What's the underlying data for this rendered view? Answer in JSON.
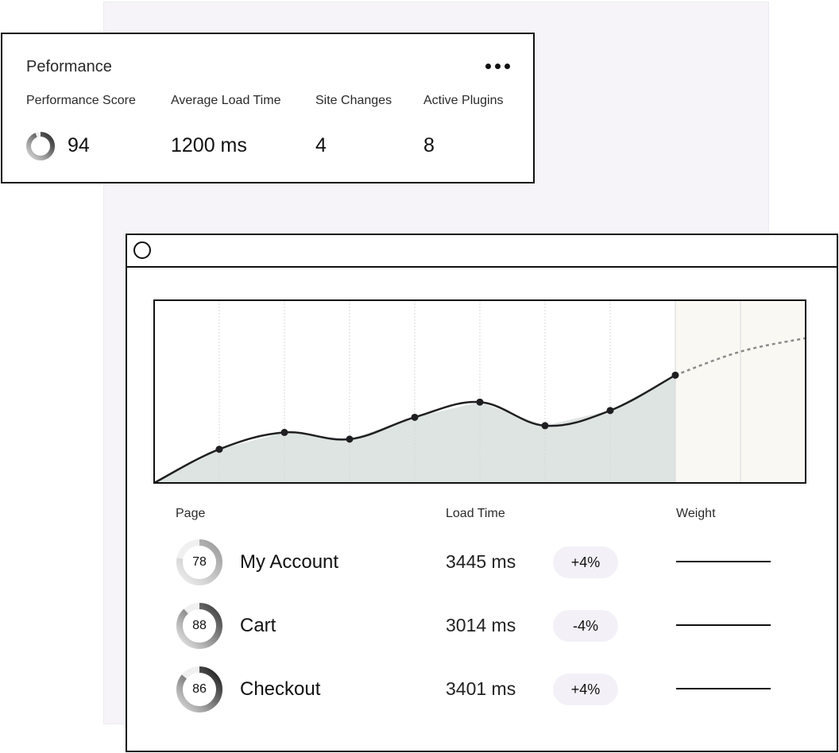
{
  "performance": {
    "title": "Peformance",
    "metrics": [
      {
        "label": "Performance Score",
        "value": "94",
        "score_fraction": 0.94
      },
      {
        "label": "Average Load Time",
        "value": "1200 ms"
      },
      {
        "label": "Site Changes",
        "value": "4"
      },
      {
        "label": "Active Plugins",
        "value": "8"
      }
    ]
  },
  "chart_data": {
    "type": "area",
    "title": "",
    "xlabel": "",
    "ylabel": "",
    "grid": true,
    "ylim": [
      0,
      100
    ],
    "series": [
      {
        "values": [
          0,
          20,
          30,
          26,
          39,
          48,
          34,
          43,
          64
        ]
      },
      {
        "projected": true,
        "values": [
          64,
          78,
          86
        ]
      }
    ]
  },
  "pages_table": {
    "headers": {
      "page": "Page",
      "load_time": "Load Time",
      "weight": "Weight"
    },
    "rows": [
      {
        "score": "78",
        "score_fraction": 0.78,
        "name": "My Account",
        "load_time": "3445 ms",
        "delta": "+4%"
      },
      {
        "score": "88",
        "score_fraction": 0.88,
        "name": "Cart",
        "load_time": "3014 ms",
        "delta": "-4%"
      },
      {
        "score": "86",
        "score_fraction": 0.86,
        "name": "Checkout",
        "load_time": "3401 ms",
        "delta": "+4%"
      }
    ]
  },
  "colors": {
    "ink": "#111111",
    "area_fill": "#dde4e1",
    "projection_fill": "#faf8f3",
    "grid": "#d9d9dd",
    "pill_bg": "#f3f1f7",
    "backdrop": "#f6f4f9"
  },
  "icons": {
    "more": "more-horizontal-icon",
    "window": "window-circle-icon"
  }
}
